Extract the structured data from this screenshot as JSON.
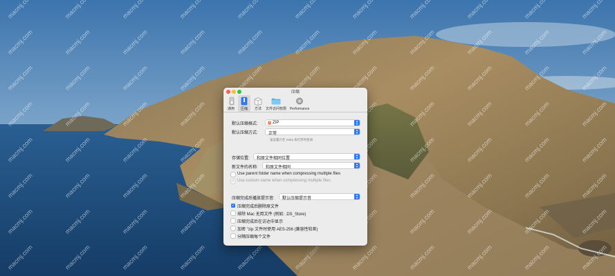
{
  "window": {
    "title": "压缩"
  },
  "toolbar": {
    "items": [
      {
        "label": "通用",
        "icon": "switch-icon",
        "selected": false
      },
      {
        "label": "压缩",
        "icon": "archive-icon",
        "selected": true
      },
      {
        "label": "方法",
        "icon": "box-icon",
        "selected": false
      },
      {
        "label": "文件访问权限",
        "icon": "folder-icon",
        "selected": false
      },
      {
        "label": "Performance",
        "icon": "gear-icon",
        "selected": false
      }
    ]
  },
  "format": {
    "label": "默认压缩格式:",
    "value": "ZIP"
  },
  "method": {
    "label": "默认压缩方式:",
    "value": "正常",
    "note": "该设置只在 Keka 未打开时生效"
  },
  "location": {
    "label": "存储位置:",
    "value": "和原文件相同位置"
  },
  "name": {
    "label": "新文件的名称:",
    "value": "和原文件相同"
  },
  "name_options": [
    {
      "label": "Use parent folder name when compressing multiple files",
      "checked": false,
      "disabled": false
    },
    {
      "label": "Use custom name when compressing multiple files",
      "checked": true,
      "disabled": true
    }
  ],
  "sound": {
    "label": "压缩完成后播放提示音:",
    "value": "默认压缩提示音"
  },
  "options": [
    {
      "label": "压缩完成后删除原文件",
      "checked": true
    },
    {
      "label": "排除 Mac 无用文件 (例如: .DS_Store)",
      "checked": false
    },
    {
      "label": "压缩完成后在访达中显示",
      "checked": false
    },
    {
      "label": "加密 \"zip 文件时使用 AES-256 (兼容性较差)",
      "checked": false
    },
    {
      "label": "分隔压缩每个文件",
      "checked": false
    }
  ],
  "watermark": "macmj.com",
  "colors": {
    "accent": "#2f7bf5",
    "window_bg": "#ececec",
    "close": "#fe5f57",
    "minimize": "#febc2e",
    "zoom": "#28c840"
  }
}
